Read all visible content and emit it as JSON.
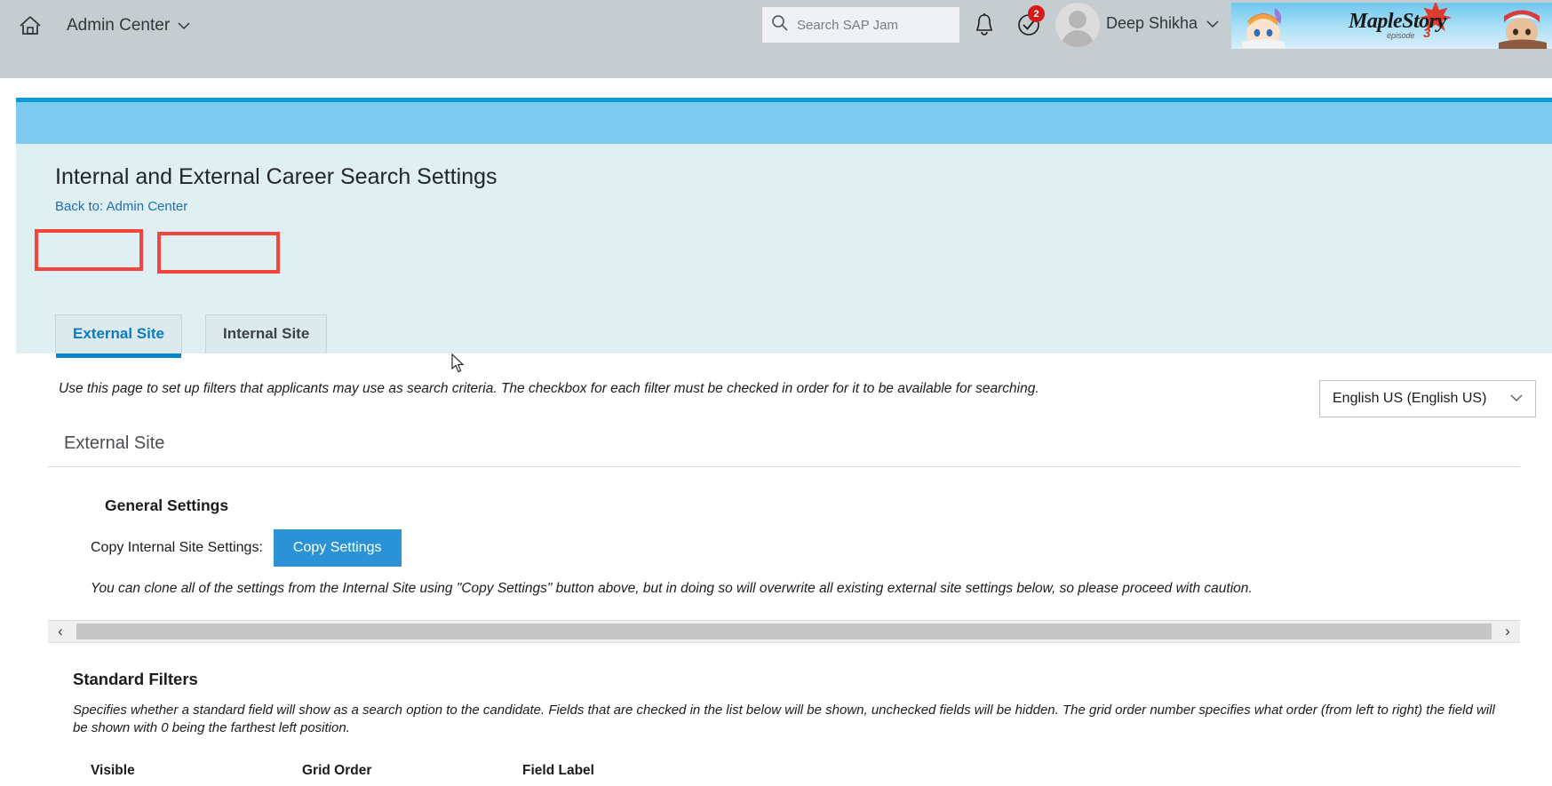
{
  "header": {
    "home_icon": "home-icon",
    "app_menu_label": "Admin Center",
    "chevron": "⌄",
    "search": {
      "placeholder": "Search SAP Jam",
      "value": "",
      "icon": "search-icon"
    },
    "notifications_icon": "bell-icon",
    "tasks_icon": "check-circle-icon",
    "tasks_badge": "2",
    "avatar": "user-avatar",
    "user_name": "Deep Shikha",
    "user_chevron": "⌄",
    "banner": {
      "title": "MapleStory",
      "subtitle": "episode",
      "episode": "3",
      "alt": "maplestory-ad-banner"
    }
  },
  "page": {
    "title": "Internal and External Career Search Settings",
    "back_link": "Back to: Admin Center",
    "tabs": [
      {
        "label": "External Site",
        "active": true
      },
      {
        "label": "Internal Site",
        "active": false
      }
    ]
  },
  "body": {
    "intro": "Use this page to set up filters that applicants may use as search criteria. The checkbox for each filter must be checked in order for it to be available for searching.",
    "language": {
      "selected": "English US (English US)",
      "chevron": "⌄"
    },
    "section_heading": "External Site",
    "general": {
      "heading": "General Settings",
      "copy_label": "Copy Internal Site Settings:",
      "copy_button": "Copy Settings",
      "caution": "You can clone all of the settings from the Internal Site using \"Copy Settings\" button above, but in doing so will overwrite all existing external site settings below, so please proceed with caution."
    },
    "scrollbar": {
      "left_arrow": "‹",
      "right_arrow": "›"
    },
    "standard_filters": {
      "heading": "Standard Filters",
      "description": "Specifies whether a standard field will show as a search option to the candidate. Fields that are checked in the list below will be shown, unchecked fields will be hidden. The grid order number specifies what order (from left to right) the field will be shown with 0 being the farthest left position.",
      "columns": [
        "Visible",
        "Grid Order",
        "Field Label"
      ]
    }
  },
  "colors": {
    "topbar": "#c5cdd0",
    "hero_rule": "#0a9ada",
    "hero": "#7ecbf0",
    "title_bg": "#e0eff1",
    "link": "#1a6fb5",
    "tab_active": "#0a7cc0",
    "highlight": "#f4453c",
    "button": "#2b93d5",
    "badge": "#d61919"
  }
}
